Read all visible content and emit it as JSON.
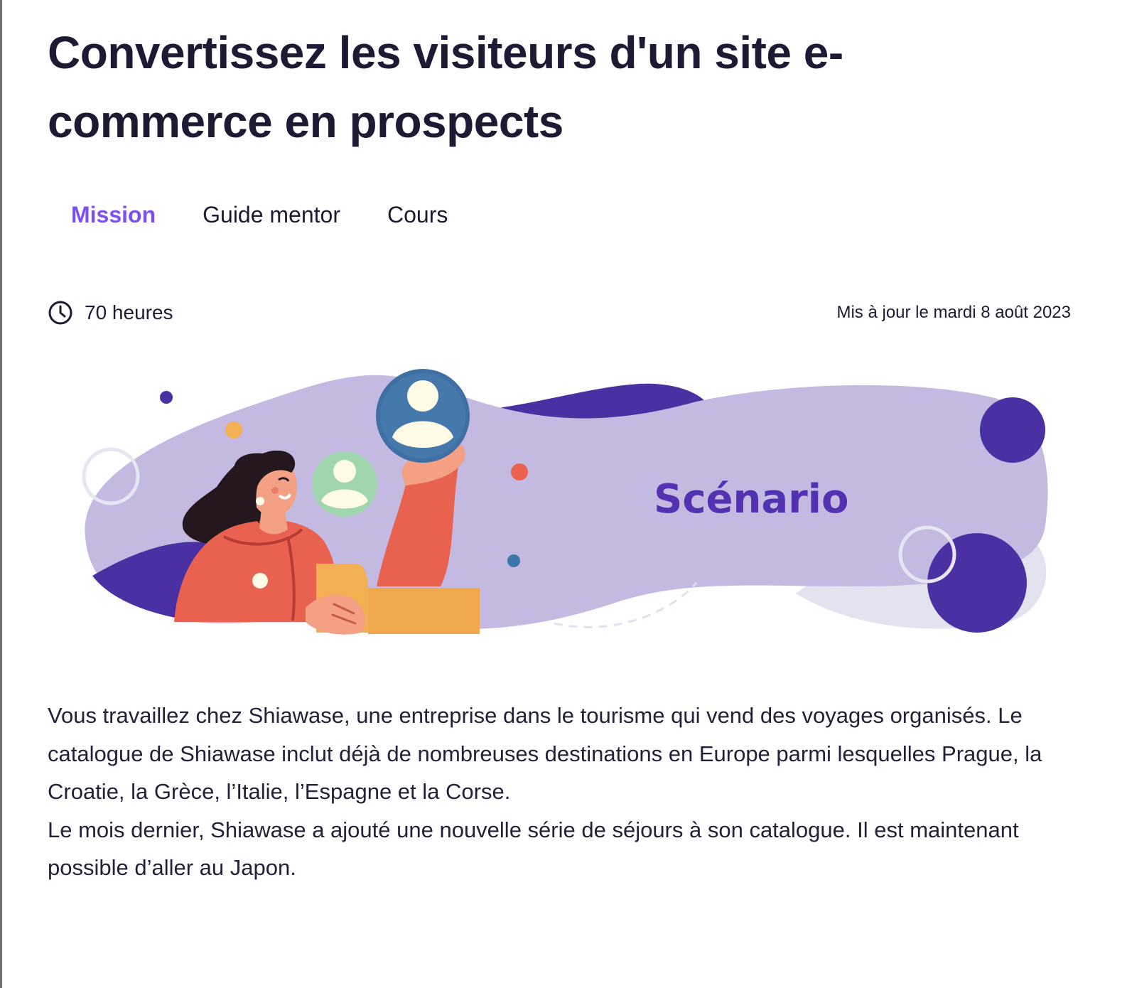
{
  "header": {
    "title": "Convertissez les visiteurs d'un site e-commerce en prospects"
  },
  "tabs": [
    {
      "label": "Mission",
      "active": true
    },
    {
      "label": "Guide mentor",
      "active": false
    },
    {
      "label": "Cours",
      "active": false
    }
  ],
  "meta": {
    "duration": "70 heures",
    "duration_icon": "clock-icon",
    "updated": "Mis à jour le mardi 8 août 2023"
  },
  "banner": {
    "title": "Scénario",
    "colors": {
      "blob": "#c4b9e1",
      "accent": "#4b30a4",
      "title": "#5232b0"
    }
  },
  "body": {
    "paragraphs": [
      "Vous travaillez chez Shiawase, une entreprise dans le tourisme qui vend des voyages organisés. Le catalogue de Shiawase inclut déjà de nombreuses destinations en Europe parmi lesquelles Prague, la Croatie, la Grèce, l’Italie, l’Espagne et la Corse.",
      "Le mois dernier, Shiawase a ajouté une nouvelle série de séjours à son catalogue. Il est maintenant possible d’aller au Japon."
    ]
  },
  "colors": {
    "accent": "#7b4ff0",
    "text": "#1f1a33"
  }
}
